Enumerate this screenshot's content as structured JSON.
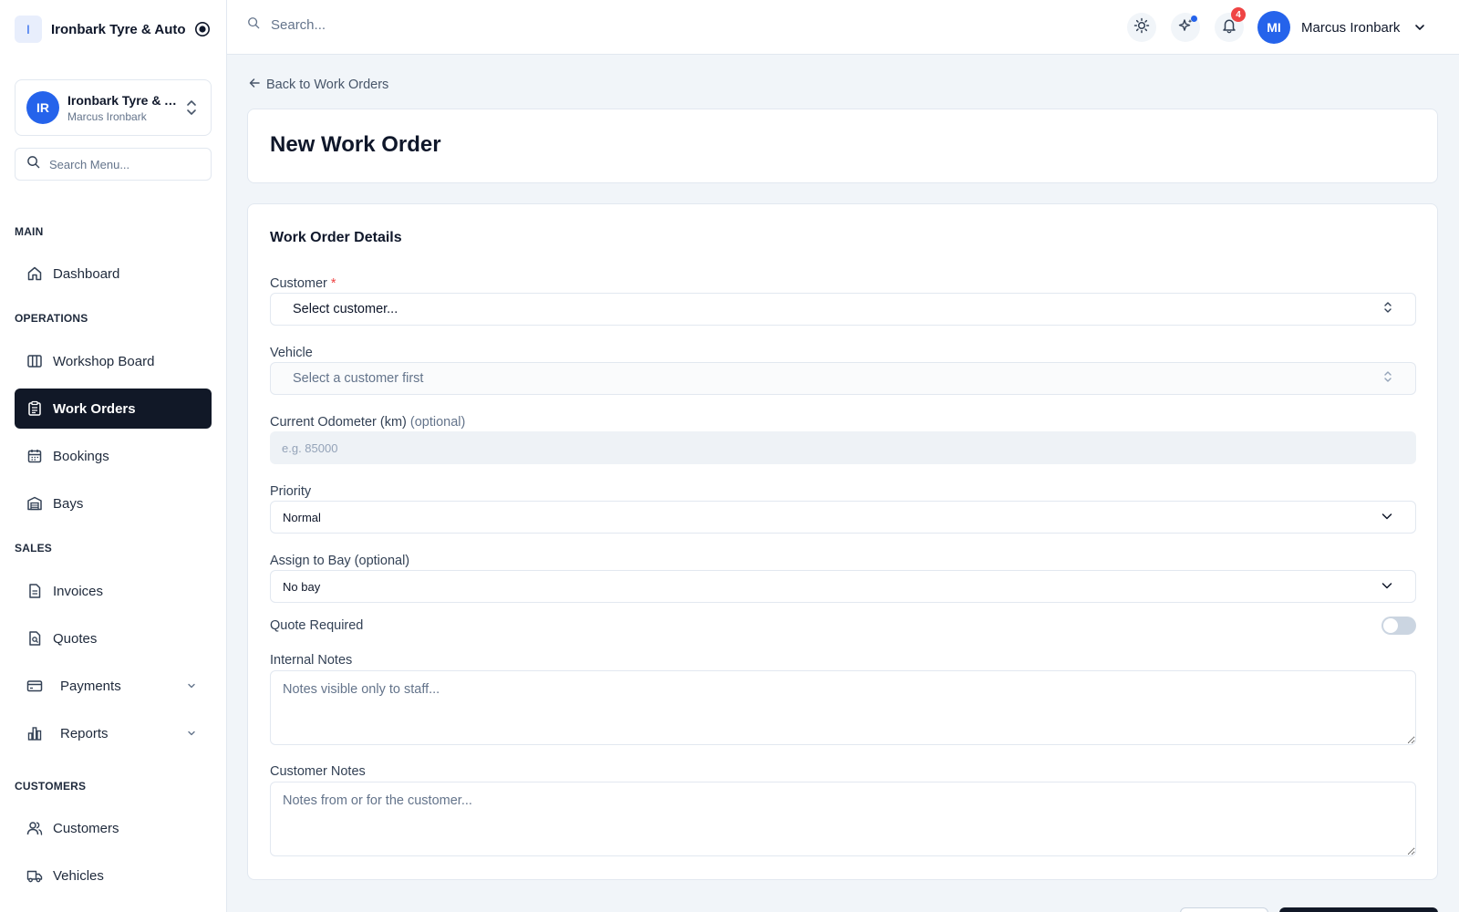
{
  "brand": {
    "logo_letter": "I",
    "name": "Ironbark Tyre & Auto"
  },
  "org": {
    "initials": "IR",
    "name": "Ironbark Tyre & Auto",
    "user": "Marcus Ironbark"
  },
  "sidebar": {
    "search_placeholder": "Search Menu...",
    "sections": {
      "main": "MAIN",
      "operations": "OPERATIONS",
      "sales": "SALES",
      "customers": "CUSTOMERS"
    },
    "items": {
      "dashboard": "Dashboard",
      "workshop_board": "Workshop Board",
      "work_orders": "Work Orders",
      "bookings": "Bookings",
      "bays": "Bays",
      "invoices": "Invoices",
      "quotes": "Quotes",
      "payments": "Payments",
      "reports": "Reports",
      "customers": "Customers",
      "vehicles": "Vehicles"
    },
    "active_item": "work_orders"
  },
  "topbar": {
    "search_placeholder": "Search...",
    "notification_count": "4",
    "user_initials": "MI",
    "user_name": "Marcus Ironbark"
  },
  "page": {
    "back_label": "Back to Work Orders",
    "title": "New Work Order"
  },
  "form": {
    "section_title": "Work Order Details",
    "customer": {
      "label": "Customer",
      "required_mark": "*",
      "value": "Select customer..."
    },
    "vehicle": {
      "label": "Vehicle",
      "value": "Select a customer first"
    },
    "odometer": {
      "label": "Current Odometer (km)",
      "optional": "(optional)",
      "placeholder": "e.g. 85000"
    },
    "priority": {
      "label": "Priority",
      "value": "Normal"
    },
    "bay": {
      "label": "Assign to Bay (optional)",
      "value": "No bay"
    },
    "quote_required": {
      "label": "Quote Required",
      "enabled": false
    },
    "internal_notes": {
      "label": "Internal Notes",
      "placeholder": "Notes visible only to staff..."
    },
    "customer_notes": {
      "label": "Customer Notes",
      "placeholder": "Notes from or for the customer..."
    }
  },
  "colors": {
    "accent": "#2563eb",
    "active_nav": "#111827",
    "badge": "#ef4444",
    "page_bg": "#f1f5f9"
  }
}
